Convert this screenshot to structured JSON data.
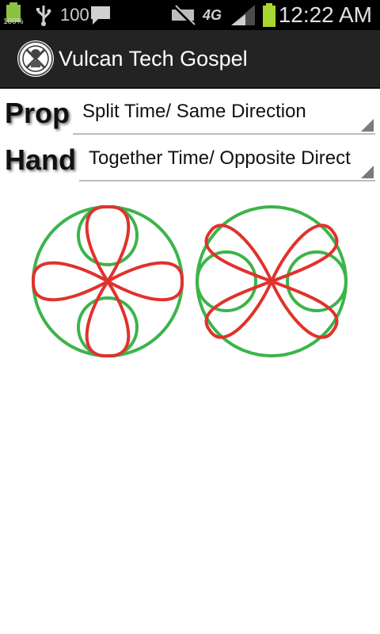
{
  "status_bar": {
    "battery_small_label": "100%",
    "notification_count": "100",
    "time": "12:22 AM",
    "network_label": "4G",
    "icons": [
      "battery-icon",
      "usb-icon",
      "message-icon",
      "mute-icon",
      "signal-icon",
      "battery-icon"
    ]
  },
  "app_bar": {
    "title": "Vulcan Tech Gospel",
    "logo_icon": "vulcan-logo-icon"
  },
  "prop": {
    "label": "Prop",
    "value": "Split Time/ Same Direction"
  },
  "hand": {
    "label": "Hand",
    "value": "Together Time/ Opposite Direction"
  },
  "colors": {
    "hand_path": "#3cb44b",
    "prop_path": "#e0322d",
    "action_bar": "#232323",
    "status_bar": "#000000"
  }
}
